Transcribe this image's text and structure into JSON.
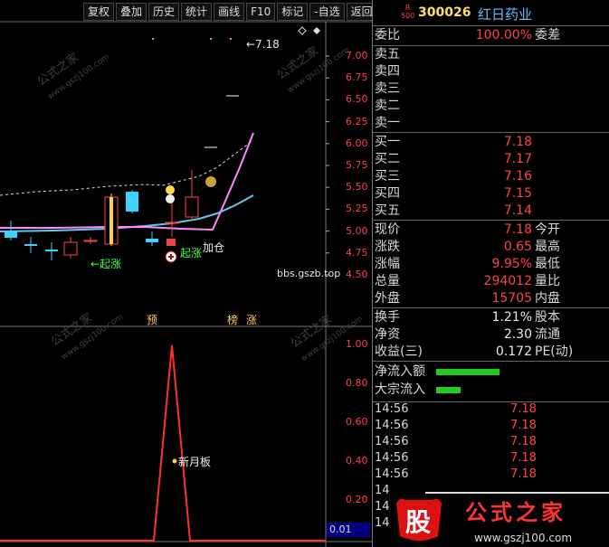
{
  "toolbar": {
    "buttons": [
      "复权",
      "叠加",
      "历史",
      "统计",
      "画线",
      "F10",
      "标记",
      "-自选",
      "返回"
    ]
  },
  "main_chart": {
    "price_axis": [
      "7.00",
      "6.75",
      "6.50",
      "6.25",
      "6.00",
      "5.75",
      "5.50",
      "5.25",
      "5.00",
      "4.75",
      "4.50"
    ],
    "high_marker": "←7.18",
    "annotations": {
      "qi_zhang_1": "←起涨",
      "qi_zhang_2": "起涨",
      "jia_cang": "加仓",
      "source": "bbs.gszb.top"
    },
    "signal_labels": [
      "预",
      "榜",
      "涨"
    ]
  },
  "indicator": {
    "axis": [
      "1.00",
      "0.80",
      "0.60",
      "0.40",
      "0.20"
    ],
    "current_value": "0.01",
    "label": "新月板"
  },
  "quote": {
    "badge_top": "R",
    "badge_bottom": "500",
    "code": "300026",
    "name": "红日药业",
    "weibi_label": "委比",
    "weibi_value": "100.00%",
    "weicha_label": "委差",
    "sell": [
      {
        "label": "卖五",
        "price": ""
      },
      {
        "label": "卖四",
        "price": ""
      },
      {
        "label": "卖三",
        "price": ""
      },
      {
        "label": "卖二",
        "price": ""
      },
      {
        "label": "卖一",
        "price": ""
      }
    ],
    "buy": [
      {
        "label": "买一",
        "price": "7.18"
      },
      {
        "label": "买二",
        "price": "7.17"
      },
      {
        "label": "买三",
        "price": "7.16"
      },
      {
        "label": "买四",
        "price": "7.15"
      },
      {
        "label": "买五",
        "price": "7.14"
      }
    ],
    "stats": [
      {
        "label": "现价",
        "value": "7.18",
        "label2": "今开"
      },
      {
        "label": "涨跌",
        "value": "0.65",
        "label2": "最高"
      },
      {
        "label": "涨幅",
        "value": "9.95%",
        "label2": "最低"
      },
      {
        "label": "总量",
        "value": "294012",
        "label2": "量比"
      },
      {
        "label": "外盘",
        "value": "15705",
        "label2": "内盘"
      }
    ],
    "stats2": [
      {
        "label": "换手",
        "value": "1.21%",
        "label2": "股本"
      },
      {
        "label": "净资",
        "value": "2.30",
        "label2": "流通"
      },
      {
        "label": "收益(三)",
        "value": "0.172",
        "label2": "PE(动)"
      }
    ],
    "flow": [
      {
        "label": "净流入额",
        "fraction": 0.9
      },
      {
        "label": "大宗流入",
        "fraction": 0.35
      }
    ],
    "ticks": [
      {
        "time": "14:56",
        "price": "7.18"
      },
      {
        "time": "14:56",
        "price": "7.18"
      },
      {
        "time": "14:56",
        "price": "7.18"
      },
      {
        "time": "14:56",
        "price": "7.18"
      },
      {
        "time": "14:56",
        "price": "7.18"
      },
      {
        "time": "14",
        "price": ""
      },
      {
        "time": "14",
        "price": ""
      },
      {
        "time": "14",
        "price": ""
      }
    ]
  },
  "watermark": {
    "site_cn": "公式之家",
    "site_url": "www.gszj100.com",
    "logo_char": "股",
    "logo_text": "公式之家",
    "logo_url": "www.gszj100.com"
  },
  "colors": {
    "up": "#ff4444",
    "down": "#40d0ff",
    "ma_pink": "#ff80ff",
    "ma_blue": "#60c8e8",
    "indicator": "#ff3030"
  }
}
